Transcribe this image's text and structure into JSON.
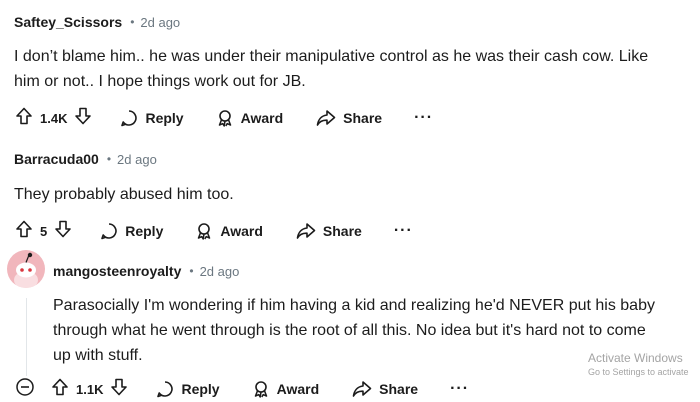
{
  "comments": [
    {
      "author": "Saftey_Scissors",
      "dot": "•",
      "time": "2d ago",
      "lines": [
        "I don’t blame him.. he was under their manipulative control as he was their cash cow. Like",
        "him or not.. I hope things work out for JB."
      ],
      "score": "1.4K",
      "reply": "Reply",
      "award": "Award",
      "share": "Share",
      "more": "···"
    },
    {
      "author": "Barracuda00",
      "dot": "•",
      "time": "2d ago",
      "lines": [
        "They probably abused him too."
      ],
      "score": "5",
      "reply": "Reply",
      "award": "Award",
      "share": "Share",
      "more": "···"
    },
    {
      "author": "mangosteenroyalty",
      "dot": "•",
      "time": "2d ago",
      "lines": [
        "Parasocially I'm wondering if him having a kid and realizing he'd NEVER put his baby",
        "through what he went through is the root of all this. No idea but it's hard not to come",
        "up with stuff."
      ],
      "score": "1.1K",
      "reply": "Reply",
      "award": "Award",
      "share": "Share",
      "more": "···"
    }
  ],
  "icons": {
    "upvote": "upvote-arrow-icon",
    "downvote": "downvote-arrow-icon",
    "reply": "speech-bubble-icon",
    "award": "award-ribbon-icon",
    "share": "share-arrow-icon",
    "collapse": "collapse-minus-icon",
    "avatar": "snoo-avatar"
  },
  "colors": {
    "text": "#1c1c1c",
    "meta": "#6b7780",
    "avatar_bg": "#f1b6bc",
    "watermark": "#a4a4a4"
  },
  "watermark": {
    "title": "Activate Windows",
    "subtitle": "Go to Settings to activate"
  }
}
